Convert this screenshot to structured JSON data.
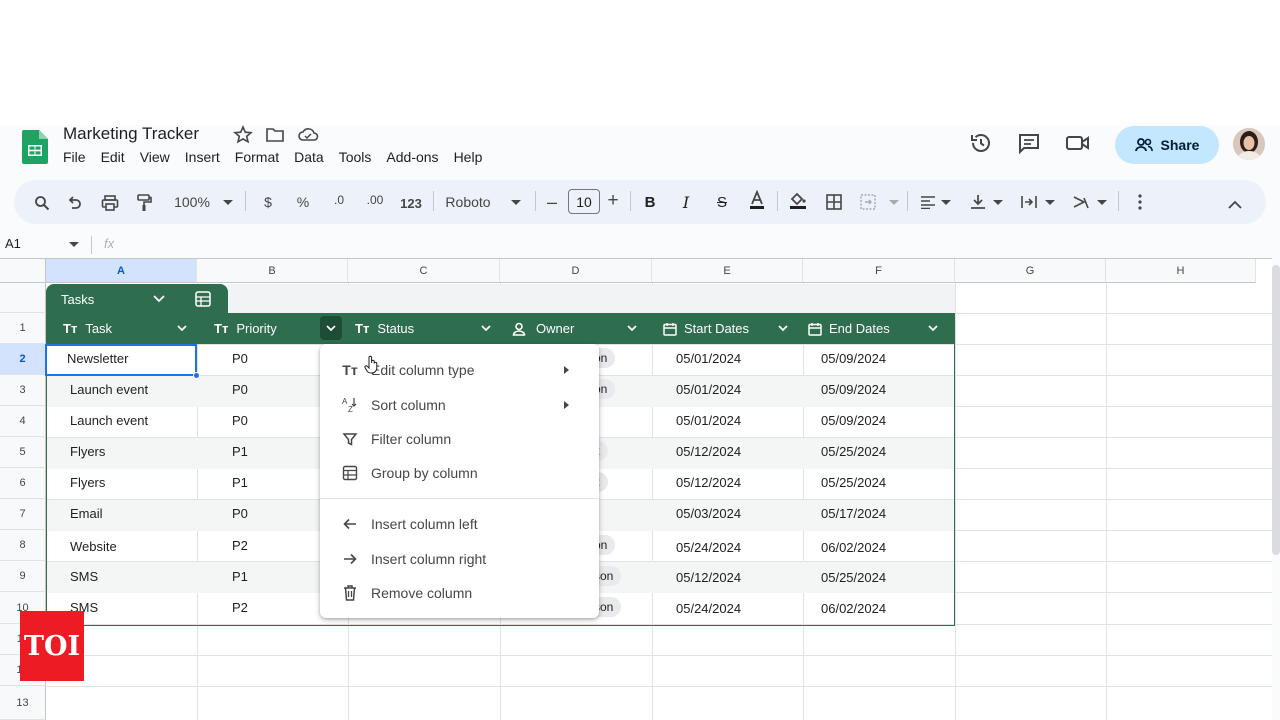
{
  "document": {
    "title": "Marketing Tracker"
  },
  "menubar": [
    "File",
    "Edit",
    "View",
    "Insert",
    "Format",
    "Data",
    "Tools",
    "Add-ons",
    "Help"
  ],
  "header": {
    "share_label": "Share"
  },
  "toolbar": {
    "zoom": "100%",
    "currency": "$",
    "percent": "%",
    "dec_decrease": ".0",
    "dec_increase": ".00",
    "number_format": "123",
    "font": "Roboto",
    "font_size": "10"
  },
  "formula_bar": {
    "cell_ref": "A1",
    "fx": "fx"
  },
  "columns": [
    "A",
    "B",
    "C",
    "D",
    "E",
    "F",
    "G",
    "H"
  ],
  "rows": [
    "1",
    "2",
    "3",
    "4",
    "5",
    "6",
    "7",
    "8",
    "9",
    "10",
    "11",
    "12",
    "13"
  ],
  "table": {
    "name": "Tasks",
    "headers": [
      {
        "label": "Task",
        "type": "Tт"
      },
      {
        "label": "Priority",
        "type": "Tт"
      },
      {
        "label": "Status",
        "type": "Tт"
      },
      {
        "label": "Owner",
        "type": "person"
      },
      {
        "label": "Start Dates",
        "type": "calendar"
      },
      {
        "label": "End Dates",
        "type": "calendar"
      }
    ],
    "rows": [
      {
        "task": "Newsletter",
        "priority": "P0",
        "owner": "on",
        "start": "05/01/2024",
        "end": "05/09/2024"
      },
      {
        "task": "Launch event",
        "priority": "P0",
        "owner": "on",
        "start": "05/01/2024",
        "end": "05/09/2024"
      },
      {
        "task": "Launch event",
        "priority": "P0",
        "owner": "",
        "start": "05/01/2024",
        "end": "05/09/2024"
      },
      {
        "task": "Flyers",
        "priority": "P1",
        "owner": "z",
        "start": "05/12/2024",
        "end": "05/25/2024"
      },
      {
        "task": "Flyers",
        "priority": "P1",
        "owner": "z",
        "start": "05/12/2024",
        "end": "05/25/2024"
      },
      {
        "task": "Email",
        "priority": "P0",
        "owner": "",
        "start": "05/03/2024",
        "end": "05/17/2024"
      },
      {
        "task": "Website",
        "priority": "P2",
        "owner": "on",
        "start": "05/24/2024",
        "end": "06/02/2024"
      },
      {
        "task": "SMS",
        "priority": "P1",
        "owner": "son",
        "start": "05/12/2024",
        "end": "05/25/2024"
      },
      {
        "task": "SMS",
        "priority": "P2",
        "owner": "son",
        "start": "05/24/2024",
        "end": "06/02/2024"
      }
    ]
  },
  "context_menu": {
    "items": [
      {
        "label": "Edit column type",
        "icon": "text-type-icon",
        "submenu": true
      },
      {
        "label": "Sort column",
        "icon": "sort-az-icon",
        "submenu": true
      },
      {
        "label": "Filter column",
        "icon": "filter-icon",
        "submenu": false
      },
      {
        "label": "Group by column",
        "icon": "group-icon",
        "submenu": false
      },
      {
        "label": "Insert column left",
        "icon": "arrow-left-icon",
        "submenu": false
      },
      {
        "label": "Insert column right",
        "icon": "arrow-right-icon",
        "submenu": false
      },
      {
        "label": "Remove column",
        "icon": "trash-icon",
        "submenu": false
      }
    ]
  },
  "watermark": {
    "text": "TOI"
  },
  "colors": {
    "table_header": "#2e6d4e",
    "share_bg": "#c2e7ff",
    "selection": "#1a73e8",
    "watermark": "#ed1c24"
  }
}
